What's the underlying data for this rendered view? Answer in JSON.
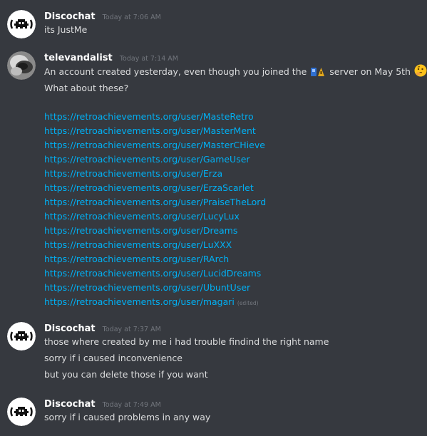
{
  "messages": [
    {
      "username": "Discochat",
      "timestamp": "Today at 7:06 AM",
      "avatar_icon": "retroachievements-logo-icon",
      "lines": [
        "its JustMe"
      ]
    },
    {
      "username": "televandalist",
      "timestamp": "Today at 7:14 AM",
      "avatar_icon": "user-photo-avatar",
      "line1_before": "An account created yesterday, even though you joined the",
      "line1_emoji": "RA-server-emoji",
      "line1_after": "server on May 5th",
      "line1_end_emoji": "thinking-face-emoji",
      "line2": "What about these?",
      "links": [
        "https://retroachievements.org/user/MasteRetro",
        "https://retroachievements.org/user/MasterMent",
        "https://retroachievements.org/user/MasterCHieve",
        "https://retroachievements.org/user/GameUser",
        "https://retroachievements.org/user/Erza",
        "https://retroachievements.org/user/ErzaScarlet",
        "https://retroachievements.org/user/PraiseTheLord",
        "https://retroachievements.org/user/LucyLux",
        "https://retroachievements.org/user/Dreams",
        "https://retroachievements.org/user/LuXXX",
        "https://retroachievements.org/user/RArch",
        "https://retroachievements.org/user/LucidDreams",
        "https://retroachievements.org/user/UbuntUser",
        "https://retroachievements.org/user/magari"
      ],
      "edited_label": "(edited)"
    },
    {
      "username": "Discochat",
      "timestamp": "Today at 7:37 AM",
      "avatar_icon": "retroachievements-logo-icon",
      "lines": [
        "those where created by me i had trouble findind the right name",
        "sorry if i caused inconvenience",
        "but you can delete those if you want"
      ]
    },
    {
      "username": "Discochat",
      "timestamp": "Today at 7:49 AM",
      "avatar_icon": "retroachievements-logo-icon",
      "lines": [
        "sorry if i caused problems in any way"
      ]
    }
  ],
  "colors": {
    "background": "#36393f",
    "link": "#00b0f4",
    "username": "#ffffff",
    "timestamp": "#72767d",
    "text": "#dcddde"
  }
}
